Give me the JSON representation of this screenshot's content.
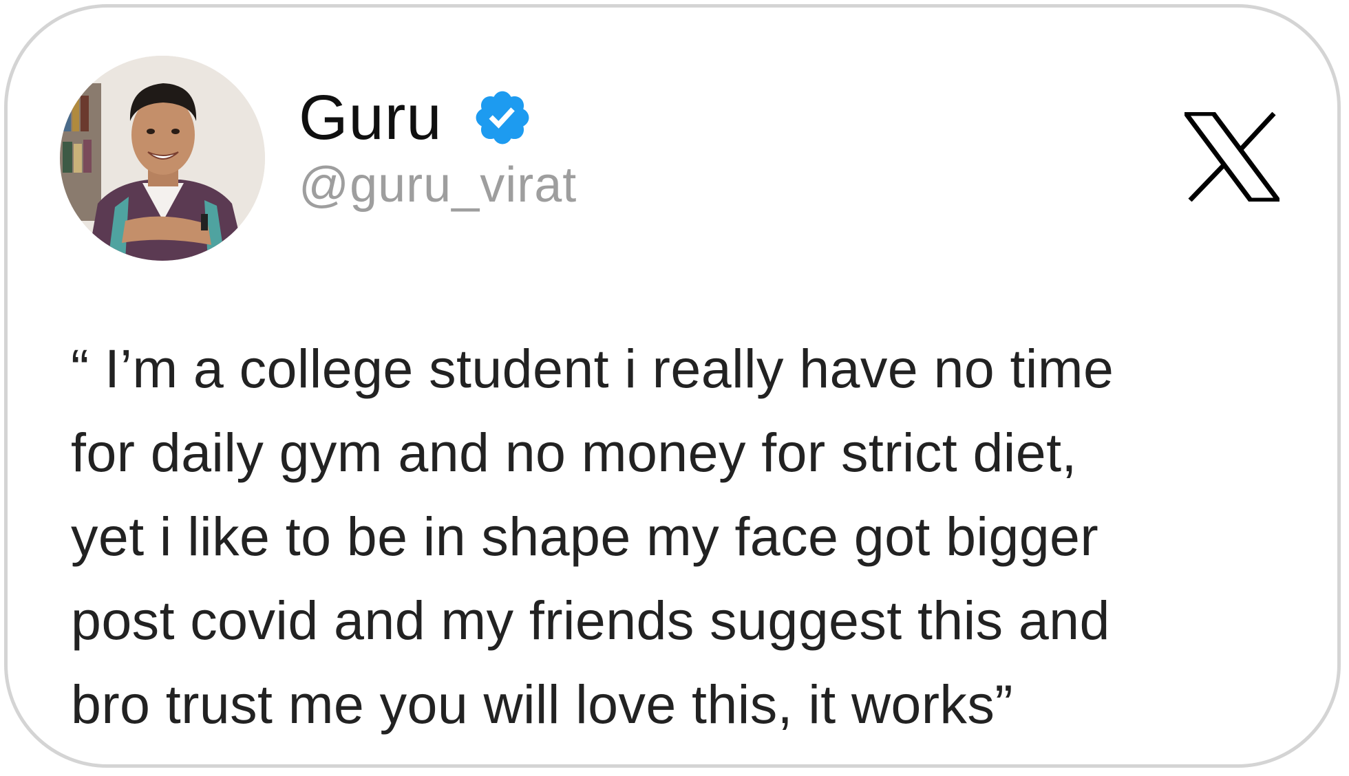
{
  "profile": {
    "name": "Guru",
    "handle": "@guru_virat",
    "verified": true,
    "avatar_description": "photo-avatar"
  },
  "brand": {
    "logo_icon": "x-logo-icon"
  },
  "tweet": {
    "lines": [
      "“ I’m a college student i really have no time",
      "for daily gym and no money for strict diet,",
      "yet i like to be in shape my face got bigger",
      "post covid and my friends suggest this and",
      "bro trust me you will love this, it works”"
    ]
  },
  "colors": {
    "badge": "#1d9bf0",
    "border": "#d4d4d4",
    "text": "#222222",
    "handle": "#9e9e9e"
  }
}
